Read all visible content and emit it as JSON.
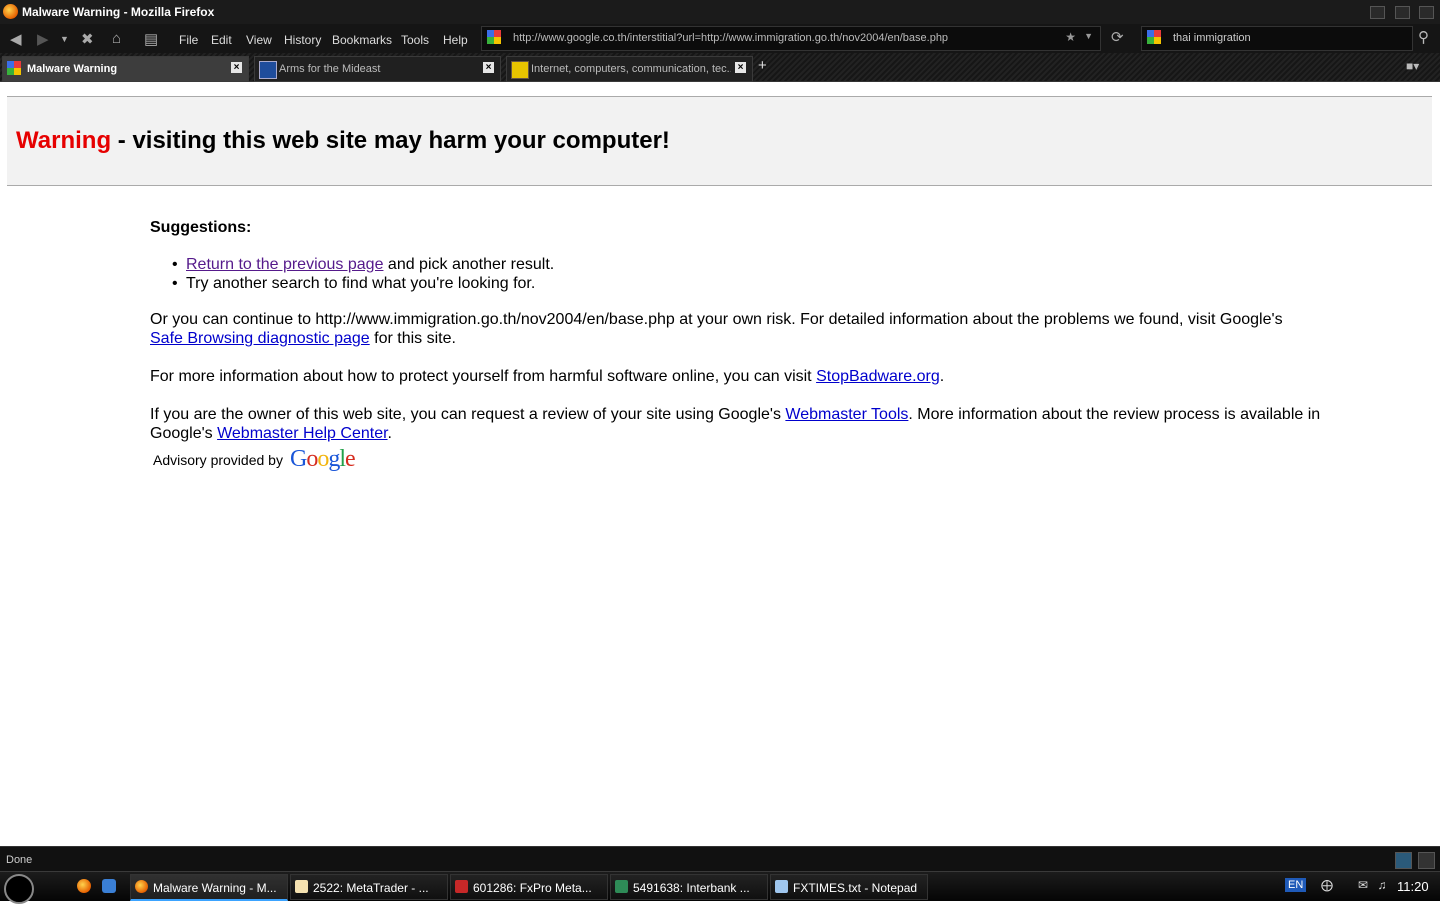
{
  "window": {
    "title": "Malware Warning - Mozilla Firefox"
  },
  "menu": [
    "File",
    "Edit",
    "View",
    "History",
    "Bookmarks",
    "Tools",
    "Help"
  ],
  "address": {
    "url": "http://www.google.co.th/interstitial?url=http://www.immigration.go.th/nov2004/en/base.php"
  },
  "search": {
    "query": "thai immigration"
  },
  "tabs": [
    {
      "label": "Malware Warning",
      "active": true
    },
    {
      "label": "Arms for the Mideast",
      "active": false
    },
    {
      "label": "Internet, computers, communication, tec...",
      "active": false
    }
  ],
  "page": {
    "warning_word": "Warning",
    "warning_rest": " - visiting this web site may harm your computer!",
    "suggestions_heading": "Suggestions:",
    "s1_link": "Return to the previous page",
    "s1_rest": " and pick another result.",
    "s2": "Try another search to find what you're looking for.",
    "p1_text": "Or you can continue to http://www.immigration.go.th/nov2004/en/base.php at your own risk. For detailed information about the problems we found, visit Google's",
    "p1_link": "Safe Browsing diagnostic page",
    "p1_tail": " for this site.",
    "p2_text": "For more information about how to protect yourself from harmful software online, you can visit ",
    "p2_link": "StopBadware.org",
    "p2_tail": ".",
    "p3_text": "If you are the owner of this web site, you can request a review of your site using Google's ",
    "p3_link": "Webmaster Tools",
    "p3_tail": ". More information about the review process is available in",
    "p3b_text": "Google's ",
    "p3b_link": "Webmaster Help Center",
    "p3b_tail": ".",
    "advisory": "Advisory provided by",
    "logo": "Google"
  },
  "status": {
    "text": "Done"
  },
  "taskbar": {
    "tasks": [
      "Malware Warning - M...",
      "2522: MetaTrader - ...",
      "601286: FxPro Meta...",
      "5491638: Interbank ...",
      "FXTIMES.txt - Notepad"
    ],
    "lang": "EN",
    "clock": "11:20"
  },
  "colors": {
    "warning_red": "#e60000",
    "link": "#0000cc",
    "visited": "#551a8b"
  }
}
